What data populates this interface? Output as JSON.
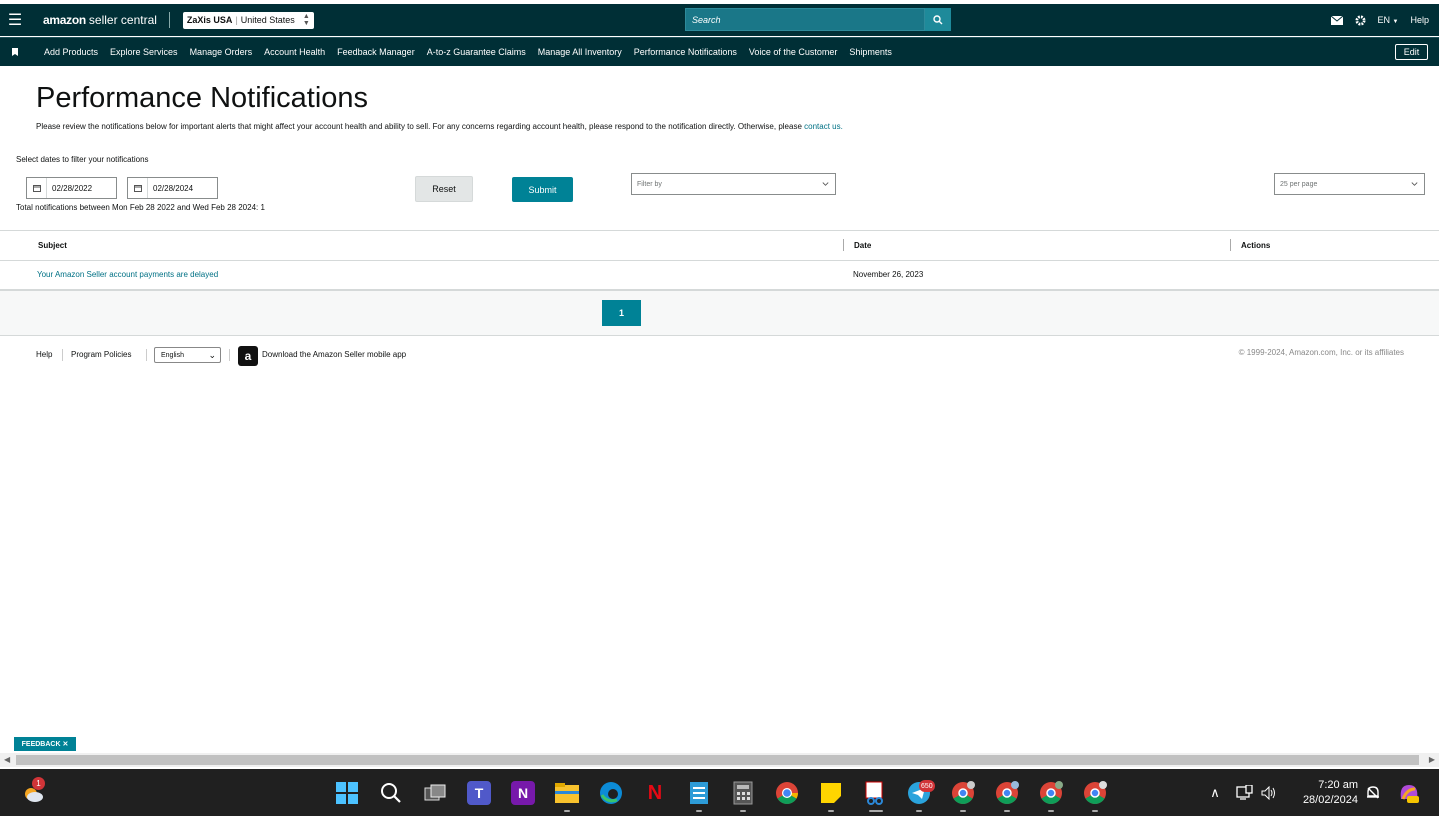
{
  "topbar": {
    "logo_brand": "amazon",
    "logo_rest": "seller central",
    "account_name": "ZaXis USA",
    "account_market": "United States",
    "search_placeholder": "Search",
    "language": "EN",
    "help": "Help"
  },
  "navbar": {
    "items": [
      "Add Products",
      "Explore Services",
      "Manage Orders",
      "Account Health",
      "Feedback Manager",
      "A-to-z Guarantee Claims",
      "Manage All Inventory",
      "Performance Notifications",
      "Voice of the Customer",
      "Shipments"
    ],
    "edit_label": "Edit"
  },
  "page": {
    "title": "Performance Notifications",
    "intro": "Please review the notifications below for important alerts that might affect your account health and ability to sell. For any concerns regarding account health, please respond to the notification directly. Otherwise, please",
    "contact_link": "contact us.",
    "filter_label": "Select dates to filter your notifications",
    "start_date": "02/28/2022",
    "end_date": "02/28/2024",
    "reset_label": "Reset",
    "submit_label": "Submit",
    "filter_by_placeholder": "Filter by",
    "per_page": "25 per page",
    "total_text": "Total notifications between Mon Feb 28 2022 and Wed Feb 28 2024: 1"
  },
  "table": {
    "headers": {
      "subject": "Subject",
      "date": "Date",
      "actions": "Actions"
    },
    "rows": [
      {
        "subject": "Your Amazon Seller account payments are delayed",
        "date": "November 26, 2023"
      }
    ]
  },
  "pagination": {
    "current_page": "1"
  },
  "footer": {
    "help": "Help",
    "policies": "Program Policies",
    "language": "English",
    "app_icon_letter": "a",
    "app_link": "Download the Amazon Seller mobile app",
    "copyright": "© 1999-2024, Amazon.com, Inc. or its affiliates"
  },
  "feedback_label": "FEEDBACK ✕",
  "taskbar": {
    "weather_badge": "1",
    "telegram_badge": "650",
    "time": "7:20 am",
    "date": "28/02/2024"
  },
  "colors": {
    "header_bg": "#002f36",
    "accent": "#008296",
    "link": "#007185"
  }
}
